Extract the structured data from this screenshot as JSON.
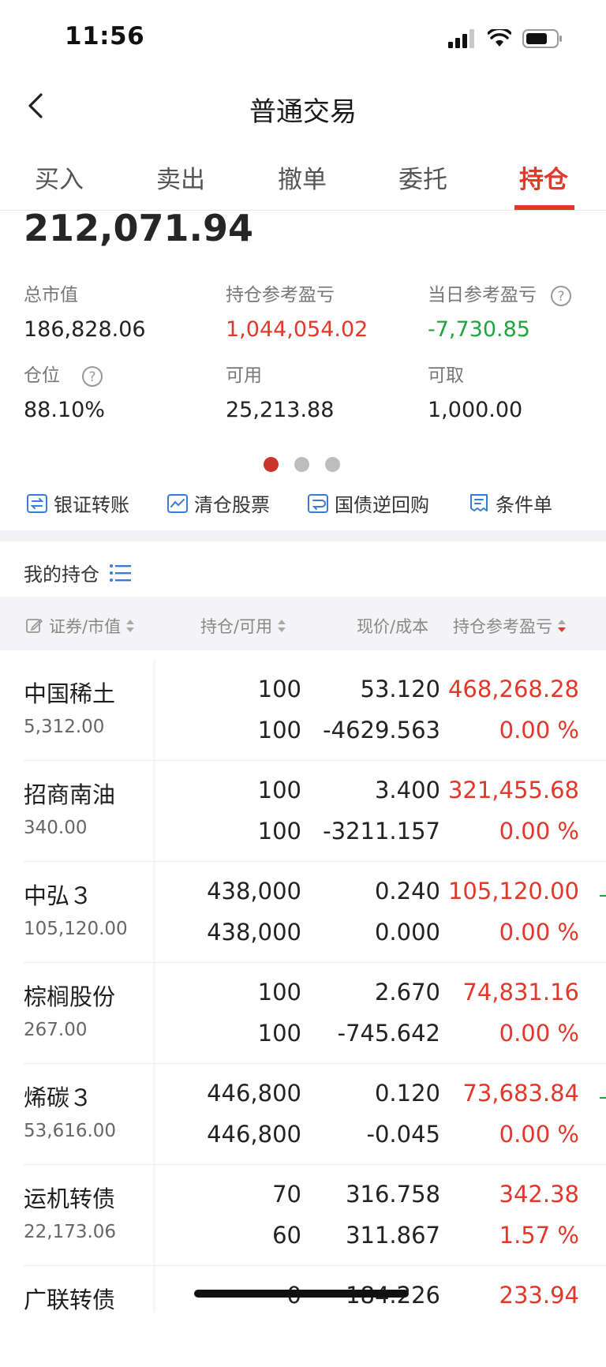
{
  "status_bar": {
    "time": "11:56"
  },
  "nav": {
    "title": "普通交易"
  },
  "tabs": [
    "买入",
    "卖出",
    "撤单",
    "委托",
    "持仓"
  ],
  "summary": {
    "total_assets": "212,071.94",
    "metrics": [
      {
        "label": "总市值",
        "value": "186,828.06",
        "tone": "normal"
      },
      {
        "label": "持仓参考盈亏",
        "value": "1,044,054.02",
        "tone": "red"
      },
      {
        "label": "当日参考盈亏",
        "value": "-7,730.85",
        "tone": "green"
      },
      {
        "label": "仓位",
        "value": "88.10%",
        "tone": "normal"
      },
      {
        "label": "可用",
        "value": "25,213.88",
        "tone": "normal"
      },
      {
        "label": "可取",
        "value": "1,000.00",
        "tone": "normal"
      }
    ]
  },
  "quick_actions": [
    "银证转账",
    "清仓股票",
    "国债逆回购",
    "条件单"
  ],
  "holdings": {
    "title": "我的持仓",
    "headers": [
      "证券/市值",
      "持仓/可用",
      "现价/成本",
      "持仓参考盈亏"
    ],
    "rows": [
      {
        "name": "中国稀土",
        "market_value": "5,312.00",
        "hold": "100",
        "avail": "100",
        "price": "53.120",
        "cost": "-4629.563",
        "pl": "468,268.28",
        "pct": "0.00 %"
      },
      {
        "name": "招商南油",
        "market_value": "340.00",
        "hold": "100",
        "avail": "100",
        "price": "3.400",
        "cost": "-3211.157",
        "pl": "321,455.68",
        "pct": "0.00 %"
      },
      {
        "name": "中弘３",
        "market_value": "105,120.00",
        "hold": "438,000",
        "avail": "438,000",
        "price": "0.240",
        "cost": "0.000",
        "pl": "105,120.00",
        "pct": "0.00 %"
      },
      {
        "name": "棕榈股份",
        "market_value": "267.00",
        "hold": "100",
        "avail": "100",
        "price": "2.670",
        "cost": "-745.642",
        "pl": "74,831.16",
        "pct": "0.00 %"
      },
      {
        "name": "烯碳３",
        "market_value": "53,616.00",
        "hold": "446,800",
        "avail": "446,800",
        "price": "0.120",
        "cost": "-0.045",
        "pl": "73,683.84",
        "pct": "0.00 %"
      },
      {
        "name": "运机转债",
        "market_value": "22,173.06",
        "hold": "70",
        "avail": "60",
        "price": "316.758",
        "cost": "311.867",
        "pl": "342.38",
        "pct": "1.57 %"
      },
      {
        "name": "广联转债",
        "market_value": "",
        "hold": "0",
        "avail": "",
        "price": "184.226",
        "cost": "",
        "pl": "233.94",
        "pct": ""
      }
    ]
  },
  "colors": {
    "accent_red": "#e2382a",
    "gain_green": "#1fa53b",
    "link_blue": "#3a7bd5"
  }
}
